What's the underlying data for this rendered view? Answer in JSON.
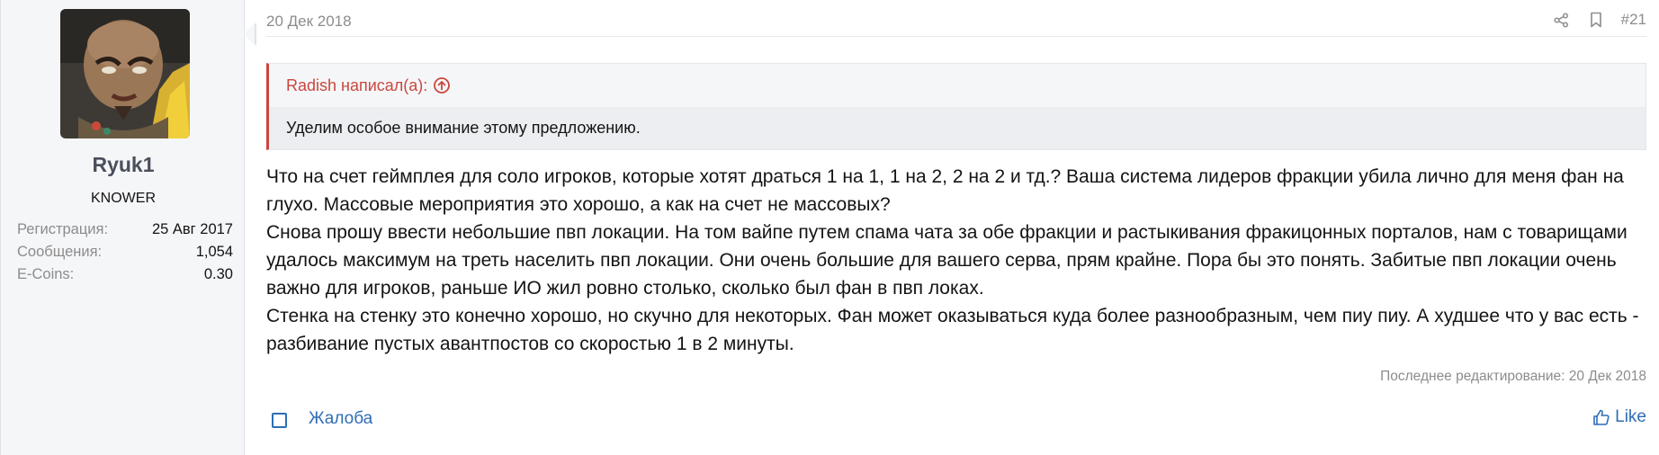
{
  "user": {
    "name": "Ryuk1",
    "title": "KNOWER",
    "extras": [
      {
        "label": "Регистрация:",
        "value": "25 Авг 2017"
      },
      {
        "label": "Сообщения:",
        "value": "1,054"
      },
      {
        "label": "E-Coins:",
        "value": "0.30"
      }
    ]
  },
  "post": {
    "date": "20 Дек 2018",
    "number": "#21",
    "quote": {
      "author": "Radish написал(а):",
      "text": "Уделим особое внимание этому предложению."
    },
    "body": [
      "Что на счет геймплея для соло игроков, которые хотят драться 1 на 1, 1 на 2, 2 на 2 и тд.? Ваша система лидеров фракции убила лично для меня фан на глухо. Массовые мероприятия это хорошо, а как на счет не массовых?",
      "Снова прошу ввести небольшие пвп локации. На том вайпе путем спама чата за обе фракции и растыкивания фракицонных порталов, нам с товарищами удалось максимум на треть населить пвп локации. Они очень большие для вашего серва, прям крайне. Пора бы это понять. Забитые пвп локации очень важно для игроков, раньше ИО жил ровно столько, сколько был фан в пвп локах.",
      "Стенка на стенку это конечно хорошо, но скучно для некоторых. Фан может оказываться куда более разнообразным, чем пиу пиу. А худшее что у вас есть - разбивание пустых авантпостов со скоростью 1 в 2 минуты."
    ],
    "last_edit": "Последнее редактирование: 20 Дек 2018",
    "report_label": "Жалоба",
    "like_label": "Like"
  },
  "colors": {
    "accent": "#2f6db5",
    "quote_border": "#c9473f",
    "muted": "#8c8c8c"
  },
  "icons": [
    "share-icon",
    "bookmark-icon",
    "arrow-up-circle-icon",
    "thumbs-up-icon"
  ]
}
